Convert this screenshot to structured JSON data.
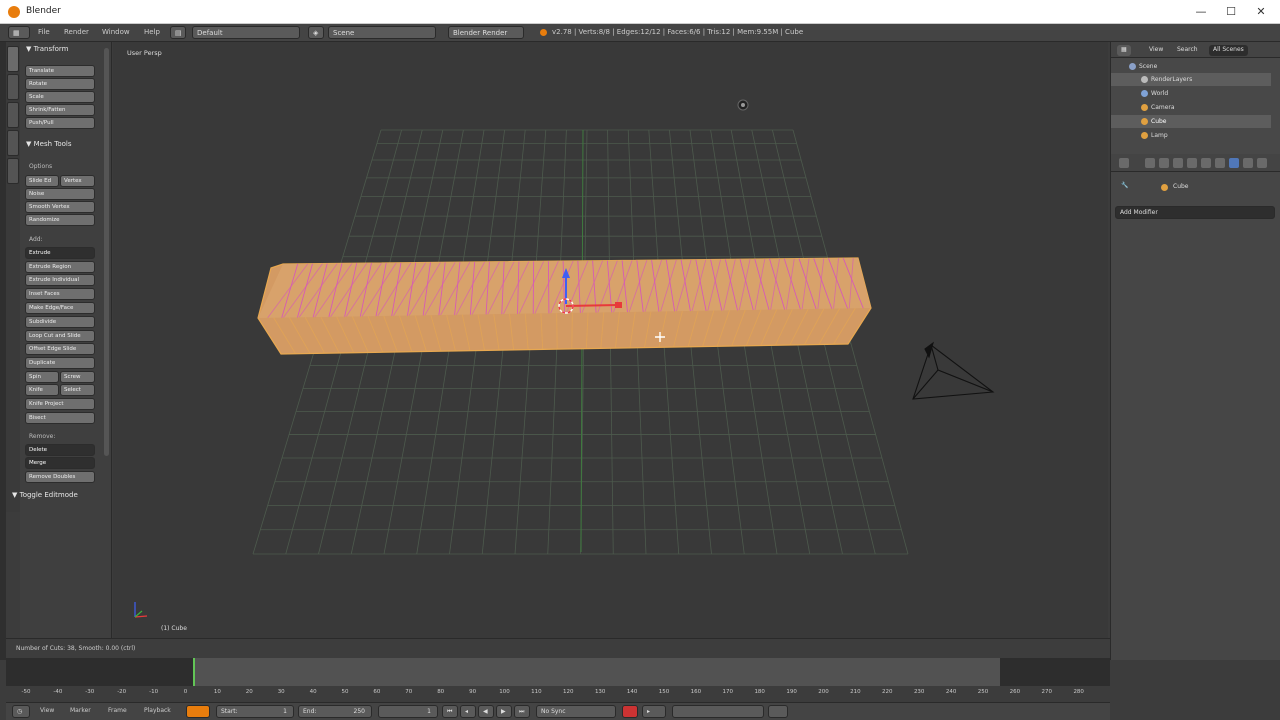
{
  "window": {
    "title": "Blender",
    "minimize": "—",
    "maximize": "☐",
    "close": "✕"
  },
  "infobar": {
    "menus": [
      "File",
      "Render",
      "Window",
      "Help"
    ],
    "layout": "Default",
    "scene": "Scene",
    "engine": "Blender Render",
    "stats": "v2.78 | Verts:8/8 | Edges:12/12 | Faces:6/6 | Tris:12 | Mem:9.55M | Cube"
  },
  "toolshelf": {
    "transform": {
      "header": "▼ Transform",
      "buttons": [
        "Translate",
        "Rotate",
        "Scale",
        "Shrink/Fatten",
        "Push/Pull"
      ]
    },
    "meshtools": {
      "header": "▼ Mesh Tools",
      "deform_label": "Options",
      "slide_edge": "Slide Ed",
      "vertex": "Vertex",
      "noise": "Noise",
      "smooth": "Smooth Vertex",
      "randomize": "Randomize",
      "add_label": "Add:",
      "extrude": "Extrude",
      "add_buttons": [
        "Extrude Region",
        "Extrude Individual",
        "Inset Faces",
        "Make Edge/Face",
        "Subdivide",
        "Loop Cut and Slide",
        "Offset Edge Slide",
        "Duplicate"
      ],
      "spin": "Spin",
      "screw": "Screw",
      "knife": "Knife",
      "select": "Select",
      "knife_project": "Knife Project",
      "bisect": "Bisect",
      "remove_label": "Remove:",
      "delete": "Delete",
      "merge": "Merge",
      "remove_doubles": "Remove Doubles"
    },
    "toggle_editmode": "▼ Toggle Editmode"
  },
  "viewport": {
    "label": "User Persp",
    "object_label": "(1) Cube"
  },
  "outliner": {
    "tabs": [
      "View",
      "Search",
      "All Scenes"
    ],
    "rows": [
      "Scene",
      "RenderLayers",
      "World",
      "Camera",
      "Cube",
      "Lamp"
    ]
  },
  "properties": {
    "object_name": "Cube",
    "add_modifier": "Add Modifier"
  },
  "status": {
    "text": "Number of Cuts: 38, Smooth: 0.00 (ctrl)"
  },
  "timeline": {
    "ticks": [
      "-50",
      "-40",
      "-30",
      "-20",
      "-10",
      "0",
      "10",
      "20",
      "30",
      "40",
      "50",
      "60",
      "70",
      "80",
      "90",
      "100",
      "110",
      "120",
      "130",
      "140",
      "150",
      "160",
      "170",
      "180",
      "190",
      "200",
      "210",
      "220",
      "230",
      "240",
      "250",
      "260",
      "270",
      "280"
    ],
    "menus": [
      "View",
      "Marker",
      "Frame",
      "Playback"
    ],
    "start_label": "Start:",
    "start": "1",
    "end_label": "End:",
    "end": "250",
    "current": "1",
    "sync": "No Sync"
  },
  "colors": {
    "accent": "#e87d0d",
    "viewport_bg": "#393939",
    "cube_fill": "#d8a06a",
    "grid": "#4f5a4f"
  }
}
